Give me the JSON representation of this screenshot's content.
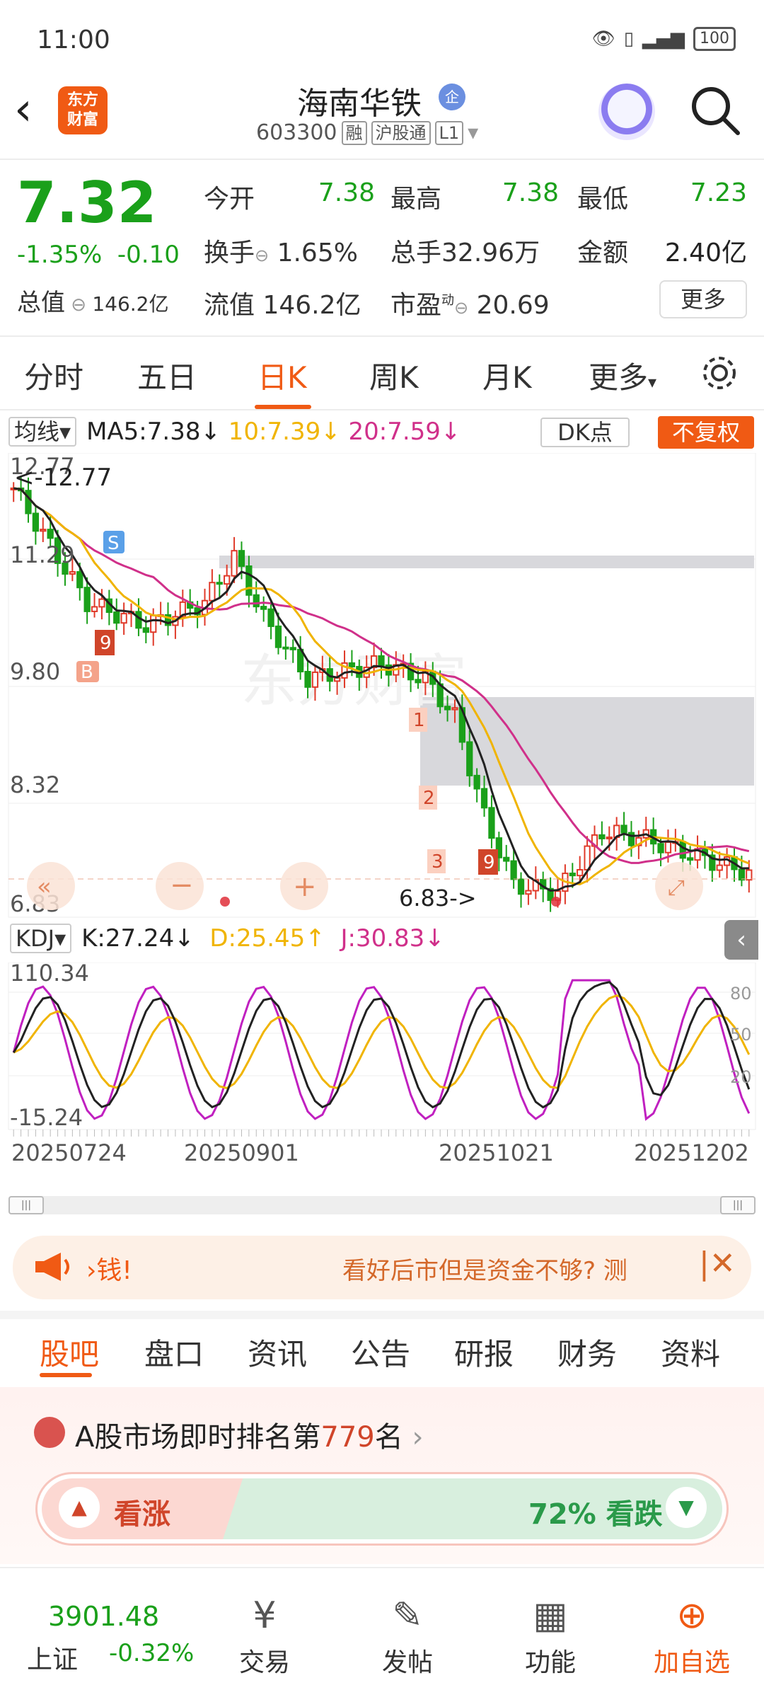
{
  "status_bar": {
    "time": "11:00",
    "battery": "100"
  },
  "header": {
    "title": "海南华铁",
    "badge": "企",
    "code": "603300",
    "tags": [
      "融",
      "沪股通",
      "L1"
    ]
  },
  "quote": {
    "price": "7.32",
    "change_pct": "-1.35%",
    "change": "-0.10",
    "total_value_label": "总值",
    "total_value": "146.2亿",
    "open_label": "今开",
    "open": "7.38",
    "high_label": "最高",
    "high": "7.38",
    "low_label": "最低",
    "low": "7.23",
    "turnover_label": "换手",
    "turnover": "1.65%",
    "volume_label": "总手",
    "volume": "32.96万",
    "amount_label": "金额",
    "amount": "2.40亿",
    "float_label": "流值",
    "float_value": "146.2亿",
    "pe_label": "市盈",
    "pe_sup": "动",
    "pe": "20.69",
    "more_label": "更多"
  },
  "period_tabs": [
    "分时",
    "五日",
    "日K",
    "周K",
    "月K",
    "更多"
  ],
  "active_period": "日K",
  "ma_bar": {
    "selector": "均线",
    "ma5": "MA5:7.38",
    "ma10": "10:7.39",
    "ma20": "20:7.59",
    "dk_label": "DK点",
    "adjust_label": "不复权"
  },
  "kdj_bar": {
    "selector": "KDJ",
    "k": "K:27.24",
    "d": "D:25.45",
    "j": "J:30.83"
  },
  "chart_data": {
    "type": "candlestick",
    "y_ticks": [
      "12.77",
      "11.29",
      "9.80",
      "8.32",
      "6.83"
    ],
    "max_label": "12.77",
    "min_label": "6.83",
    "x_ticks": [
      "20250724",
      "20250901",
      "20251021",
      "20251202"
    ],
    "ylim": [
      6.83,
      12.77
    ],
    "kdj_ylim": [
      -15.24,
      110.34
    ],
    "kdj_ticks": [
      "110.34",
      "-15.24"
    ],
    "kdj_right_ticks": [
      "80",
      "50",
      "20"
    ],
    "colors": {
      "up": "#e03a2a",
      "down": "#1aa01a",
      "ma5": "#222222",
      "ma10": "#f0b400",
      "ma20": "#d0308a"
    },
    "watermark": "东方财富",
    "signal_labels": [
      "S",
      "B",
      "1",
      "2",
      "3",
      "9"
    ]
  },
  "ad": {
    "left": "钱!",
    "text": "看好后市但是资金不够? 测"
  },
  "bottom_tabs": [
    "股吧",
    "盘口",
    "资讯",
    "公告",
    "研报",
    "财务",
    "资料"
  ],
  "active_bottom_tab": "股吧",
  "rank": {
    "prefix": "A股市场即时排名第",
    "number": "779",
    "suffix": "名"
  },
  "vote": {
    "up_label": "看涨",
    "down_label": "72% 看跌"
  },
  "nav": {
    "index_value": "3901.48",
    "index_name": "上证",
    "index_change": "-0.32%",
    "trade": "交易",
    "post": "发帖",
    "function": "功能",
    "add": "加自选"
  }
}
